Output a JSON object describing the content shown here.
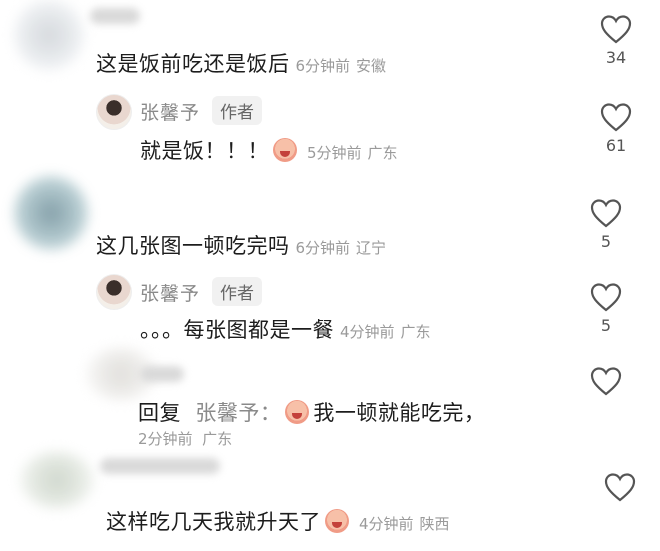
{
  "author": {
    "name": "张馨予",
    "tag": "作者"
  },
  "comments": [
    {
      "text": "这是饭前吃还是饭后",
      "time": "6分钟前",
      "location": "安徽",
      "likes": "34"
    },
    {
      "text": "就是饭！！！",
      "time": "5分钟前",
      "location": "广东",
      "likes": "61"
    },
    {
      "text": "这几张图一顿吃完吗",
      "time": "6分钟前",
      "location": "辽宁",
      "likes": "5"
    },
    {
      "text": "。。。每张图都是一餐",
      "time": "4分钟前",
      "location": "广东",
      "likes": "5"
    },
    {
      "reply_label": "回复",
      "reply_to": "张馨予：",
      "text": "我一顿就能吃完，",
      "time": "2分钟前",
      "location": "广东"
    },
    {
      "text": "这样吃几天我就升天了",
      "time": "4分钟前",
      "location": "陕西"
    }
  ],
  "icons": {
    "like": "heart-outline-icon",
    "emoji": "laughing-face-emoji-icon"
  }
}
